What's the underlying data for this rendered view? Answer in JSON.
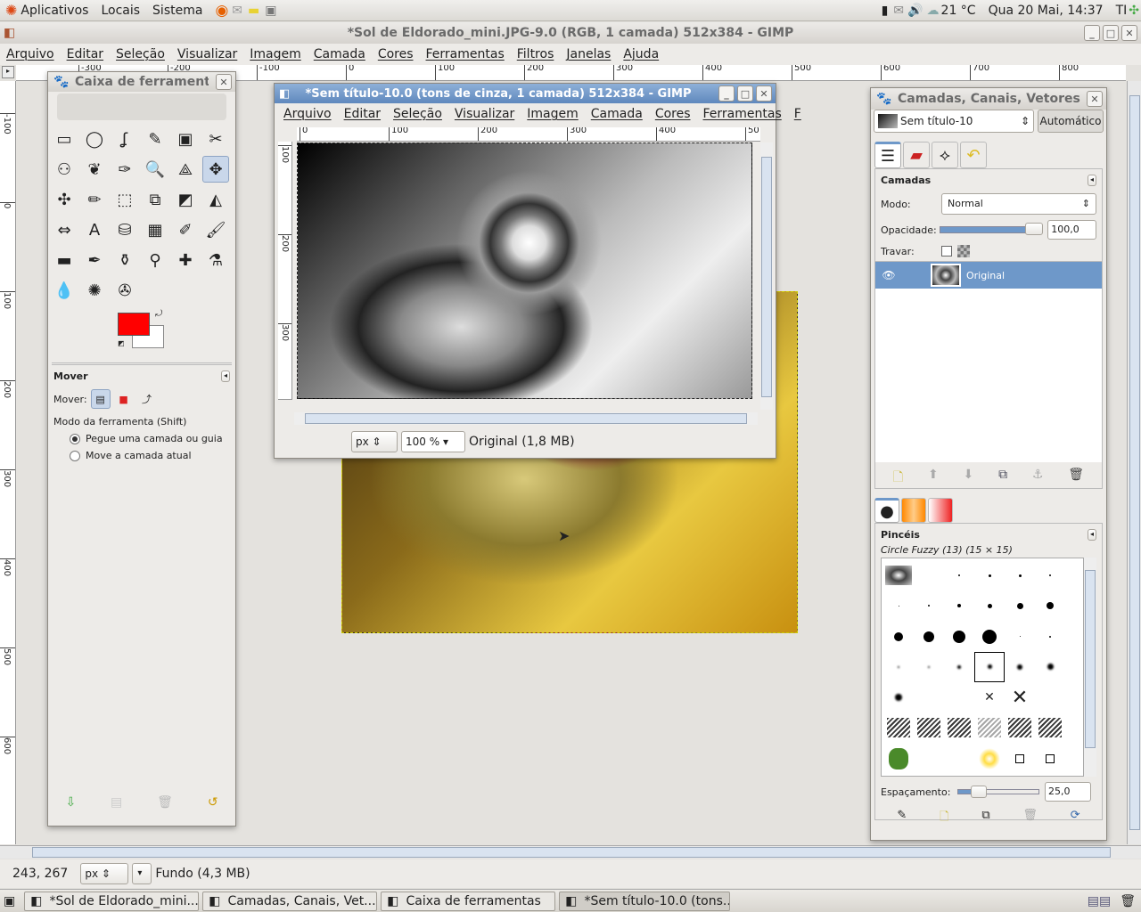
{
  "top_panel": {
    "menus": [
      "Aplicativos",
      "Locais",
      "Sistema"
    ],
    "weather": "21 °C",
    "clock": "Qua 20 Mai, 14:37",
    "user": "TI"
  },
  "main_window": {
    "title": "*Sol de Eldorado_mini.JPG-9.0 (RGB, 1 camada) 512x384 - GIMP",
    "menu": [
      "Arquivo",
      "Editar",
      "Seleção",
      "Visualizar",
      "Imagem",
      "Camada",
      "Cores",
      "Ferramentas",
      "Filtros",
      "Janelas",
      "Ajuda"
    ],
    "ruler_ticks": [
      "-300",
      "-200",
      "-100",
      "0",
      "100",
      "200",
      "300",
      "400",
      "500",
      "600",
      "700",
      "800"
    ],
    "vruler_ticks": [
      "-100",
      "0",
      "100",
      "200",
      "300",
      "400",
      "500",
      "600"
    ],
    "status": {
      "coords": "243, 267",
      "unit": "px",
      "layer": "Fundo (4,3 MB)"
    }
  },
  "toolbox": {
    "title": "Caixa de ferramentas",
    "tools": [
      "▭",
      "◯",
      "ʆ",
      "✎",
      "▣",
      "✂",
      "⚇",
      "❦",
      "✑",
      "🔍",
      "⟁",
      "✥",
      "✣",
      "✏",
      "⬚",
      "⧉",
      "◩",
      "◭",
      "⇔",
      "A",
      "⛁",
      "▦",
      "✐",
      "🖌",
      "▬",
      "✒",
      "⚱",
      "⚲",
      "✚",
      "⚗",
      "💧",
      "✺",
      "✇"
    ],
    "fg_color": "#ff0000",
    "bg_color": "#ffffff",
    "options": {
      "title": "Mover",
      "mover_label": "Mover:",
      "mode_label": "Modo da ferramenta (Shift)",
      "radio1": "Pegue uma camada ou guia",
      "radio2": "Move a camada atual",
      "radio_selected": 1
    }
  },
  "image_window": {
    "title": "*Sem título-10.0 (tons de cinza, 1 camada) 512x384 - GIMP",
    "menu": [
      "Arquivo",
      "Editar",
      "Seleção",
      "Visualizar",
      "Imagem",
      "Camada",
      "Cores",
      "Ferramentas",
      "F"
    ],
    "ruler_ticks": [
      "0",
      "100",
      "200",
      "300",
      "400",
      "50"
    ],
    "vruler_ticks": [
      "100",
      "200",
      "300"
    ],
    "unit": "px",
    "zoom": "100 %",
    "status": "Original (1,8 MB)"
  },
  "layers_dock": {
    "title": "Camadas, Canais, Vetores, ",
    "image_select": "Sem título-10",
    "auto_button": "Automático",
    "section": "Camadas",
    "mode_label": "Modo:",
    "mode_value": "Normal",
    "opacity_label": "Opacidade:",
    "opacity_value": "100,0",
    "opacity_percent": 100,
    "lock_label": "Travar:",
    "layers": [
      {
        "name": "Original",
        "visible": true,
        "selected": true
      }
    ],
    "brushes": {
      "section": "Pincéis",
      "current": "Circle Fuzzy (13) (15 × 15)",
      "spacing_label": "Espaçamento:",
      "spacing_value": "25,0"
    }
  },
  "taskbar": {
    "items": [
      "*Sol de Eldorado_mini...",
      "Camadas, Canais, Vet...",
      "Caixa de ferramentas",
      "*Sem título-10.0 (tons..."
    ],
    "active": 3
  },
  "colors": {
    "selection_blue": "#6e98c9",
    "accent": "#3a6ea5"
  }
}
